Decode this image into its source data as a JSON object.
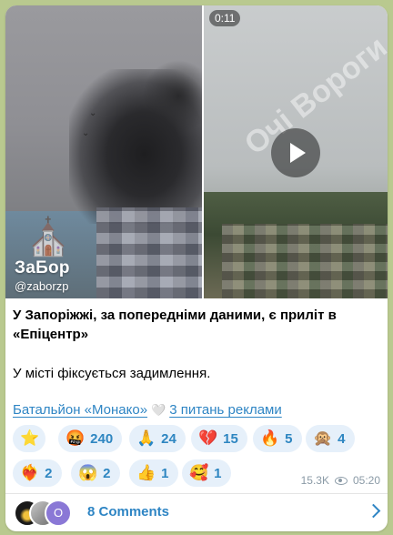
{
  "media": {
    "duration": "0:11",
    "left_brand": "ЗаБор",
    "left_handle": "@zaborzp",
    "right_watermark": "Очі Вороги"
  },
  "post": {
    "headline": "У Запоріжжі, за попередніми даними, є приліт в «Епіцентр»",
    "body": "У місті фіксується задимлення."
  },
  "links": {
    "first": "Батальйон «Монако»",
    "second": "3 питань реклами"
  },
  "reactions": [
    {
      "emoji": "⭐",
      "count": ""
    },
    {
      "emoji": "🤬",
      "count": "240"
    },
    {
      "emoji": "🙏",
      "count": "24"
    },
    {
      "emoji": "💔",
      "count": "15"
    },
    {
      "emoji": "🔥",
      "count": "5"
    },
    {
      "emoji": "🙊",
      "count": "4"
    },
    {
      "emoji": "❤️‍🔥",
      "count": "2"
    },
    {
      "emoji": "😱",
      "count": "2"
    },
    {
      "emoji": "👍",
      "count": "1"
    },
    {
      "emoji": "🥰",
      "count": "1"
    }
  ],
  "meta": {
    "views": "15.3K",
    "time": "05:20"
  },
  "comments": {
    "label": "8 Comments",
    "avatar_letter": "O"
  },
  "colors": {
    "background": "#b9c98f",
    "accent": "#2e85c4",
    "chip": "#e6f0fa"
  }
}
